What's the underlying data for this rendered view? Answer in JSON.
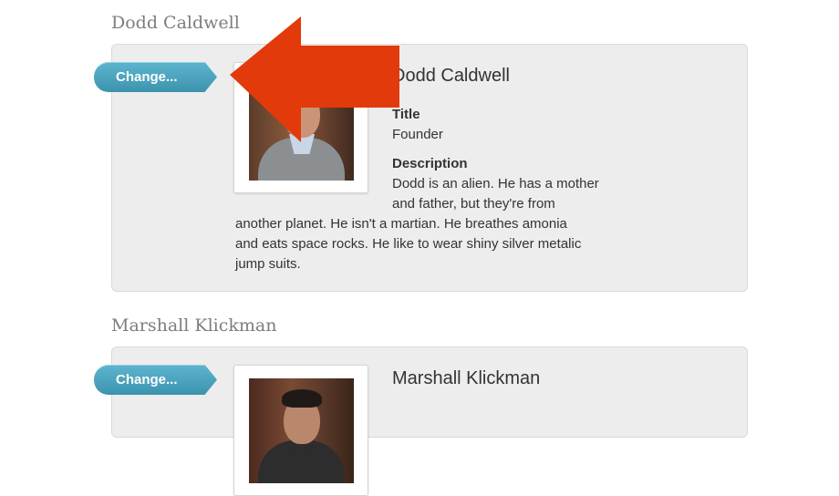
{
  "people": [
    {
      "section_heading": "Dodd Caldwell",
      "change_label": "Change...",
      "name": "Dodd Caldwell",
      "title_label": "Title",
      "title_value": "Founder",
      "description_label": "Description",
      "description_lines": [
        "Dodd is an alien. He has a mother",
        "and father, but they're from",
        "another planet. He isn't a martian. He breathes amonia",
        "and eats space rocks. He like to wear shiny silver metalic",
        "jump suits."
      ]
    },
    {
      "section_heading": "Marshall Klickman",
      "change_label": "Change...",
      "name": "Marshall Klickman"
    }
  ],
  "annotation": {
    "arrow_icon": "arrow-left-icon",
    "arrow_color": "#e23a0b"
  },
  "colors": {
    "button_top": "#5cb5cf",
    "button_bottom": "#3c93ad",
    "card_bg": "#ededed",
    "heading": "#7d7d7d"
  }
}
